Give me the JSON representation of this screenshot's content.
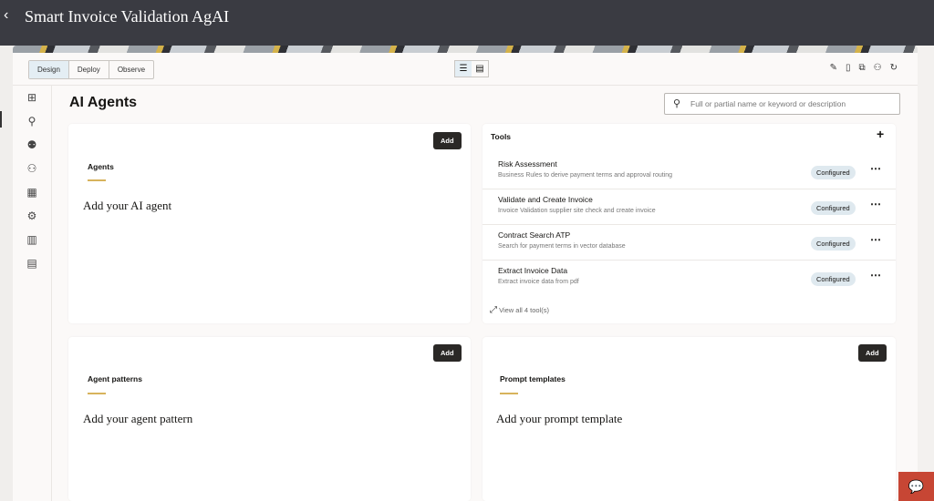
{
  "header": {
    "back_icon": "‹",
    "title": "Smart Invoice Validation AgAI"
  },
  "toolbar": {
    "modes": [
      "Design",
      "Deploy",
      "Observe"
    ],
    "active_mode": "Design"
  },
  "page_title": "AI Agents",
  "search": {
    "placeholder": "Full or partial name or keyword or description"
  },
  "agents": {
    "title": "Agents",
    "add": "Add",
    "empty": "Add your AI agent"
  },
  "tools": {
    "title": "Tools",
    "add_icon": "+",
    "items": [
      {
        "name": "Risk Assessment",
        "desc": "Business Rules to derive payment terms and approval routing",
        "status": "Configured"
      },
      {
        "name": "Validate and Create Invoice",
        "desc": "Invoice Validation supplier site check and create invoice",
        "status": "Configured"
      },
      {
        "name": "Contract Search ATP",
        "desc": "Search for payment terms in vector database",
        "status": "Configured"
      },
      {
        "name": "Extract Invoice Data",
        "desc": "Extract invoice data from pdf",
        "status": "Configured"
      }
    ],
    "view_all": "View all 4 tool(s)"
  },
  "patterns": {
    "title": "Agent patterns",
    "add": "Add",
    "empty": "Add your agent pattern"
  },
  "prompts": {
    "title": "Prompt templates",
    "add": "Add",
    "empty": "Add your prompt template"
  }
}
